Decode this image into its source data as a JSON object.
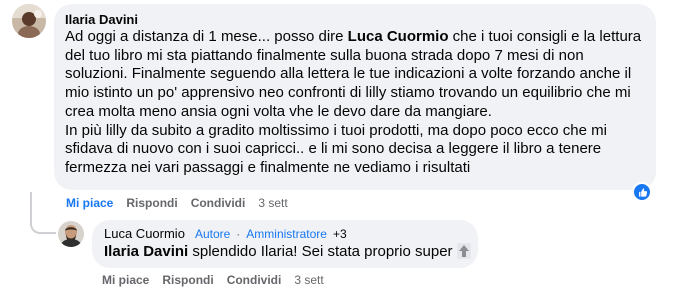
{
  "comment": {
    "author": "Ilaria Davini",
    "avatar_icon": "user-photo-avatar",
    "text_lines": [
      [
        "Ad oggi a distanza di 1 mese... posso dire ",
        "Luca Cuormio",
        " che i tuoi consigli e la lettura"
      ],
      [
        "del tuo libro mi sta piattando finalmente sulla buona strada dopo 7 mesi di non"
      ],
      [
        "soluzioni. Finalmente seguendo alla lettera le tue indicazioni a volte forzando anche il"
      ],
      [
        "mio istinto un po' apprensivo neo confronti di lilly stiamo trovando un equilibrio che mi"
      ],
      [
        "crea molta meno ansia ogni volta vhe le devo dare da mangiare."
      ],
      [
        "In più lilly da subito a gradito moltissimo i tuoi prodotti, ma dopo poco ecco che mi"
      ],
      [
        "sfidava di nuovo con i suoi capricci.. e li mi sono decisa a leggere il libro a tenere"
      ],
      [
        "fermezza nei vari passaggi e finalmente ne vediamo i risultati"
      ]
    ],
    "actions": {
      "like": "Mi piace",
      "reply": "Rispondi",
      "share": "Condividi",
      "time": "3 sett"
    },
    "reaction_icon": "like-thumb-icon",
    "reaction_color": "#1877f2"
  },
  "reply": {
    "author": "Luca Cuormio",
    "badge_author": "Autore",
    "badge_separator": "·",
    "badge_admin": "Amministratore",
    "badge_count": "+3",
    "mention": "Ilaria Davini",
    "text": " splendido Ilaria! Sei stata proprio super",
    "emoji_icon": "up-arrow-emoji-icon",
    "actions": {
      "like": "Mi piace",
      "reply": "Rispondi",
      "share": "Condividi",
      "time": "3 sett"
    }
  },
  "colors": {
    "bubble_bg": "#f0f2f5",
    "link_blue": "#1877f2",
    "meta_gray": "#65676b"
  }
}
